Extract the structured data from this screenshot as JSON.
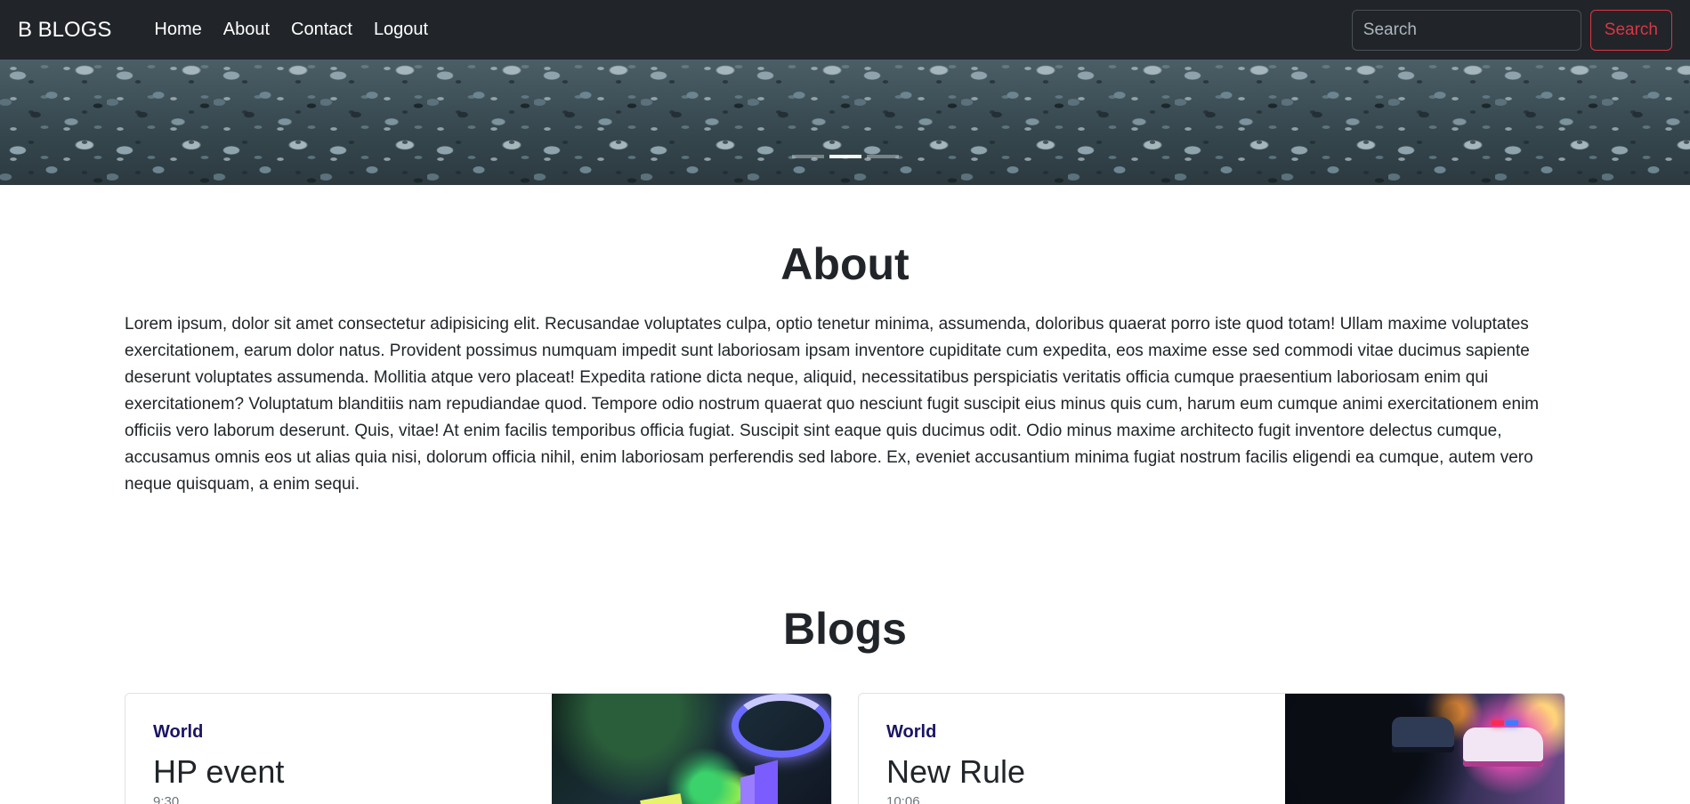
{
  "navbar": {
    "brand": "B BLOGS",
    "links": [
      "Home",
      "About",
      "Contact",
      "Logout"
    ],
    "search_placeholder": "Search",
    "search_button": "Search"
  },
  "hero": {
    "indicator_count": 3,
    "active_indicator": 2
  },
  "about": {
    "title": "About",
    "text": "Lorem ipsum, dolor sit amet consectetur adipisicing elit. Recusandae voluptates culpa, optio tenetur minima, assumenda, doloribus quaerat porro iste quod totam! Ullam maxime voluptates exercitationem, earum dolor natus. Provident possimus numquam impedit sunt laboriosam ipsam inventore cupiditate cum expedita, eos maxime esse sed commodi vitae ducimus sapiente deserunt voluptates assumenda. Mollitia atque vero placeat! Expedita ratione dicta neque, aliquid, necessitatibus perspiciatis veritatis officia cumque praesentium laboriosam enim qui exercitationem? Voluptatum blanditiis nam repudiandae quod. Tempore odio nostrum quaerat quo nesciunt fugit suscipit eius minus quis cum, harum eum cumque animi exercitationem enim officiis vero laborum deserunt. Quis, vitae! At enim facilis temporibus officia fugiat. Suscipit sint eaque quis ducimus odit. Odio minus maxime architecto fugit inventore delectus cumque, accusamus omnis eos ut alias quia nisi, dolorum officia nihil, enim laboriosam perferendis sed labore. Ex, eveniet accusantium minima fugiat nostrum facilis eligendi ea cumque, autem vero neque quisquam, a enim sequi."
  },
  "blogs": {
    "title": "Blogs",
    "cards": [
      {
        "category": "World",
        "title": "HP event",
        "time": "9:30"
      },
      {
        "category": "World",
        "title": "New Rule",
        "time": "10:06"
      }
    ]
  },
  "colors": {
    "navbar_bg": "#212529",
    "search_button": "#dc3545",
    "category": "#1a1464"
  }
}
